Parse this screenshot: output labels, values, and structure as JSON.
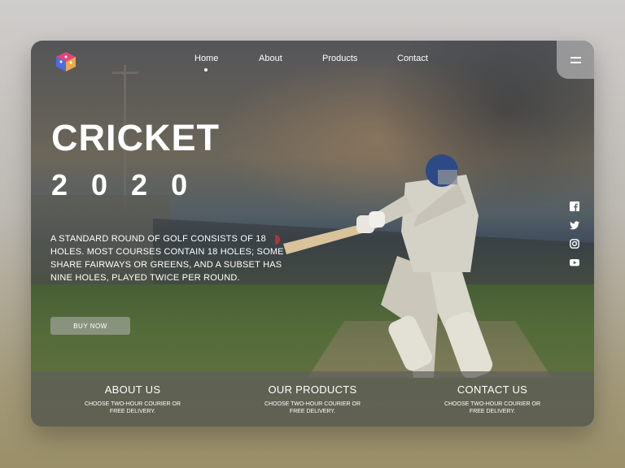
{
  "nav": {
    "items": [
      {
        "label": "Home",
        "active": true
      },
      {
        "label": "About"
      },
      {
        "label": "Products"
      },
      {
        "label": "Contact"
      }
    ]
  },
  "hero": {
    "title": "CRICKET",
    "year": "2020",
    "description": "A STANDARD ROUND OF GOLF CONSISTS OF 18 HOLES. MOST COURSES CONTAIN 18 HOLES; SOME SHARE FAIRWAYS OR GREENS, AND A SUBSET HAS NINE HOLES, PLAYED TWICE PER ROUND.",
    "cta_label": "BUY NOW"
  },
  "social": [
    "facebook-icon",
    "twitter-icon",
    "instagram-icon",
    "youtube-icon"
  ],
  "footer": {
    "columns": [
      {
        "title": "ABOUT US",
        "text": "CHOOSE TWO-HOUR COURIER OR FREE DELIVERY."
      },
      {
        "title": "OUR PRODUCTS",
        "text": "CHOOSE TWO-HOUR COURIER OR FREE DELIVERY."
      },
      {
        "title": "CONTACT US",
        "text": "CHOOSE TWO-HOUR COURIER OR FREE DELIVERY."
      }
    ]
  },
  "colors": {
    "text": "#ffffff",
    "logo_pink": "#e0467c",
    "logo_blue": "#4b6de0",
    "logo_orange": "#f0a84a"
  }
}
